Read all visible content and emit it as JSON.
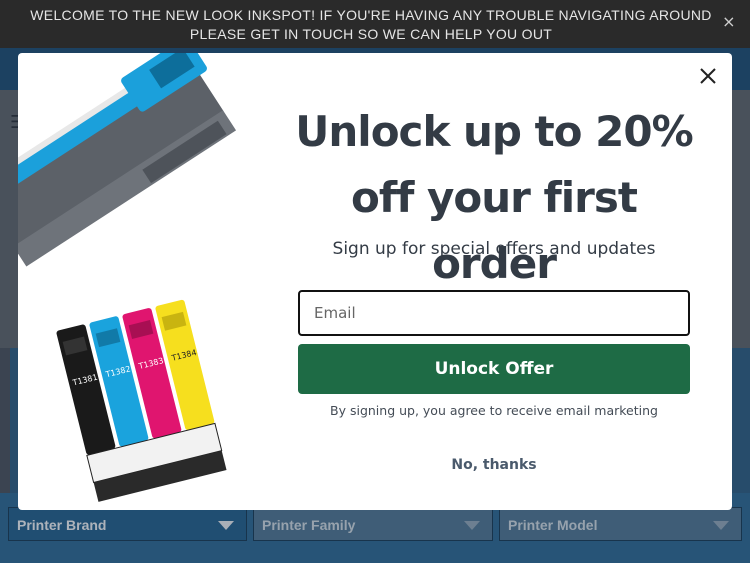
{
  "announcement": {
    "text": "WELCOME TO THE NEW LOOK INKSPOT! IF YOU'RE HAVING ANY TROUBLE NAVIGATING AROUND PLEASE GET IN TOUCH SO WE CAN HELP YOU OUT",
    "close_icon": "close-icon"
  },
  "background": {
    "filters": [
      {
        "label": "Printer Brand"
      },
      {
        "label": "Printer Family"
      },
      {
        "label": "Printer Model"
      }
    ]
  },
  "popup": {
    "headline": "Unlock up to 20% off your first order",
    "subheadline": "Sign up for special offers and updates",
    "email_placeholder": "Email",
    "cta_label": "Unlock Offer",
    "legal": "By signing up, you agree to receive email marketing",
    "decline_label": "No, thanks",
    "image_icon": "ink-cartridges-image",
    "cartridges": [
      "T1381",
      "T1382",
      "T1383",
      "T1384"
    ]
  },
  "colors": {
    "cta": "#1e6b45",
    "headline": "#333b45",
    "cartridge_black": "#1a1a1a",
    "cartridge_cyan": "#1aa3dd",
    "cartridge_magenta": "#e0156f",
    "cartridge_yellow": "#f6df1e",
    "toner_blue": "#1ba0db"
  }
}
